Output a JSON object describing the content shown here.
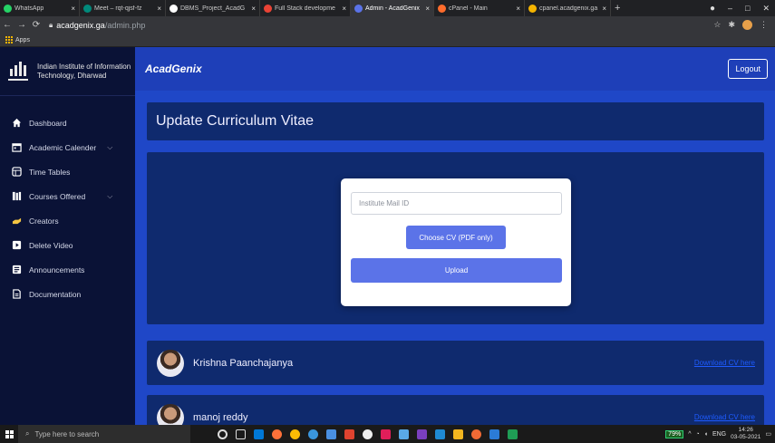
{
  "browser": {
    "tabs": [
      {
        "label": "WhatsApp",
        "color": "#25d366"
      },
      {
        "label": "Meet – rqt-qjsf-fz",
        "color": "#00897b"
      },
      {
        "label": "DBMS_Project_AcadG",
        "color": "#ffffff"
      },
      {
        "label": "Full Stack developme",
        "color": "#ea4335"
      },
      {
        "label": "Admin - AcadGenix",
        "color": "#5b73e8"
      },
      {
        "label": "cPanel - Main",
        "color": "#ff6c2c"
      },
      {
        "label": "cpanel.acadgenix.ga",
        "color": "#f4b400"
      }
    ],
    "new_tab": "+",
    "window_controls": {
      "minimize": "–",
      "restore": "□",
      "close": "✕"
    },
    "url_host": "acadgenix.ga",
    "url_path": "/admin.php",
    "bookmarks_label": "Apps"
  },
  "sidebar": {
    "institute_name": "Indian Institute of Information Technology, Dharwad",
    "items": [
      {
        "label": "Dashboard",
        "icon": "home-icon",
        "chevron": false
      },
      {
        "label": "Academic Calender",
        "icon": "calendar-icon",
        "chevron": true
      },
      {
        "label": "Time Tables",
        "icon": "table-icon",
        "chevron": false
      },
      {
        "label": "Courses Offered",
        "icon": "books-icon",
        "chevron": true
      },
      {
        "label": "Creators",
        "icon": "hand-icon",
        "chevron": false
      },
      {
        "label": "Delete Video",
        "icon": "video-icon",
        "chevron": false
      },
      {
        "label": "Announcements",
        "icon": "megaphone-icon",
        "chevron": false
      },
      {
        "label": "Documentation",
        "icon": "document-icon",
        "chevron": false
      }
    ]
  },
  "topbar": {
    "brand": "AcadGenix",
    "logout_label": "Logout"
  },
  "main": {
    "title": "Update Curriculum Vitae",
    "form": {
      "mail_placeholder": "Institute Mail ID",
      "mail_value": "",
      "choose_label": "Choose CV (PDF only)",
      "upload_label": "Upload"
    },
    "people": [
      {
        "name": "Krishna Paanchajanya",
        "link": "Download CV here"
      },
      {
        "name": "manoj reddy",
        "link": "Download CV here"
      }
    ]
  },
  "taskbar": {
    "search_placeholder": "Type here to search",
    "battery": "79%",
    "language": "ENG",
    "time": "14:26",
    "date": "03-05-2021"
  },
  "colors": {
    "sidebar_bg": "#0a1236",
    "main_bg": "#1f47c7",
    "card_bg": "#0f2a6e",
    "button": "#5b73e8",
    "link": "#1e5bff"
  }
}
